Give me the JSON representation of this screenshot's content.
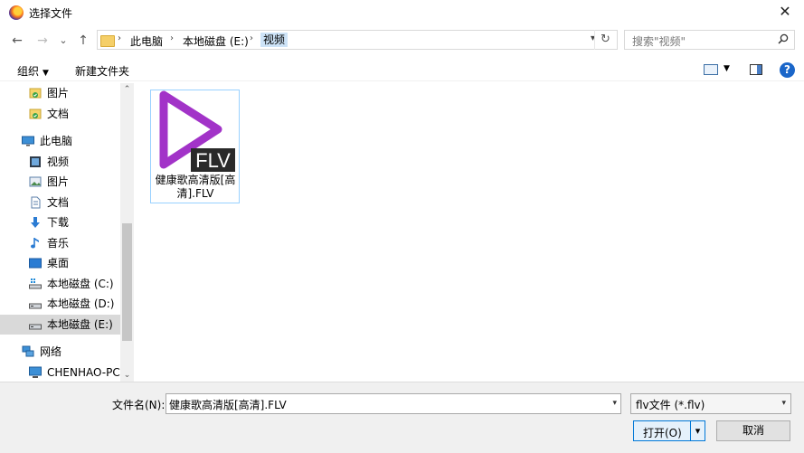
{
  "window": {
    "title": "选择文件",
    "close_glyph": "✕"
  },
  "nav": {
    "back_glyph": "←",
    "forward_glyph": "→",
    "recent_glyph": "⌄",
    "up_glyph": "↑",
    "breadcrumbs": [
      "此电脑",
      "本地磁盘 (E:)",
      "视频"
    ],
    "refresh_glyph": "↻",
    "search_placeholder": "搜索\"视频\""
  },
  "toolbar": {
    "organize_label": "组织",
    "new_folder_label": "新建文件夹",
    "help_glyph": "?"
  },
  "sidebar": {
    "items": [
      {
        "label": "图片",
        "icon": "pictures-icon"
      },
      {
        "label": "文档",
        "icon": "documents-icon"
      },
      {
        "label": "此电脑",
        "icon": "computer-icon"
      },
      {
        "label": "视频",
        "icon": "videos-icon"
      },
      {
        "label": "图片",
        "icon": "pictures-icon"
      },
      {
        "label": "文档",
        "icon": "documents-icon"
      },
      {
        "label": "下载",
        "icon": "download-icon"
      },
      {
        "label": "音乐",
        "icon": "music-icon"
      },
      {
        "label": "桌面",
        "icon": "desktop-icon"
      },
      {
        "label": "本地磁盘 (C:)",
        "icon": "drive-icon"
      },
      {
        "label": "本地磁盘 (D:)",
        "icon": "drive-icon"
      },
      {
        "label": "本地磁盘 (E:)",
        "icon": "drive-icon",
        "selected": true
      },
      {
        "label": "网络",
        "icon": "network-icon"
      },
      {
        "label": "CHENHAO-PC",
        "icon": "pc-icon"
      }
    ]
  },
  "files": [
    {
      "name": "健康歌高清版[高清].FLV",
      "badge": "FLV"
    }
  ],
  "footer": {
    "filename_label": "文件名(N):",
    "filename_value": "健康歌高清版[高清].FLV",
    "filetype_value": "flv文件 (*.flv)",
    "open_label": "打开(O)",
    "cancel_label": "取消"
  },
  "colors": {
    "accent": "#0078d7",
    "play_icon": "#a233c8",
    "selection": "#cde3f7"
  }
}
